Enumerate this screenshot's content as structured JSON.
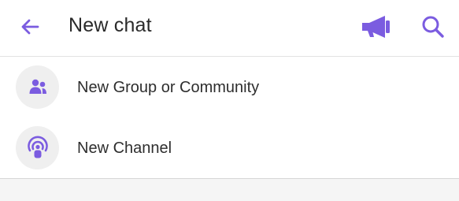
{
  "header": {
    "title": "New chat",
    "back_icon": "arrow-left-icon",
    "broadcast_icon": "megaphone-icon",
    "search_icon": "search-icon"
  },
  "menu": {
    "items": [
      {
        "label": "New Group or Community",
        "icon": "group-icon"
      },
      {
        "label": "New Channel",
        "icon": "channel-icon"
      }
    ]
  },
  "colors": {
    "accent": "#7b5ce0",
    "text": "#2a2a2a",
    "icon_circle_bg": "#efefef",
    "divider": "#e2e2e2"
  }
}
